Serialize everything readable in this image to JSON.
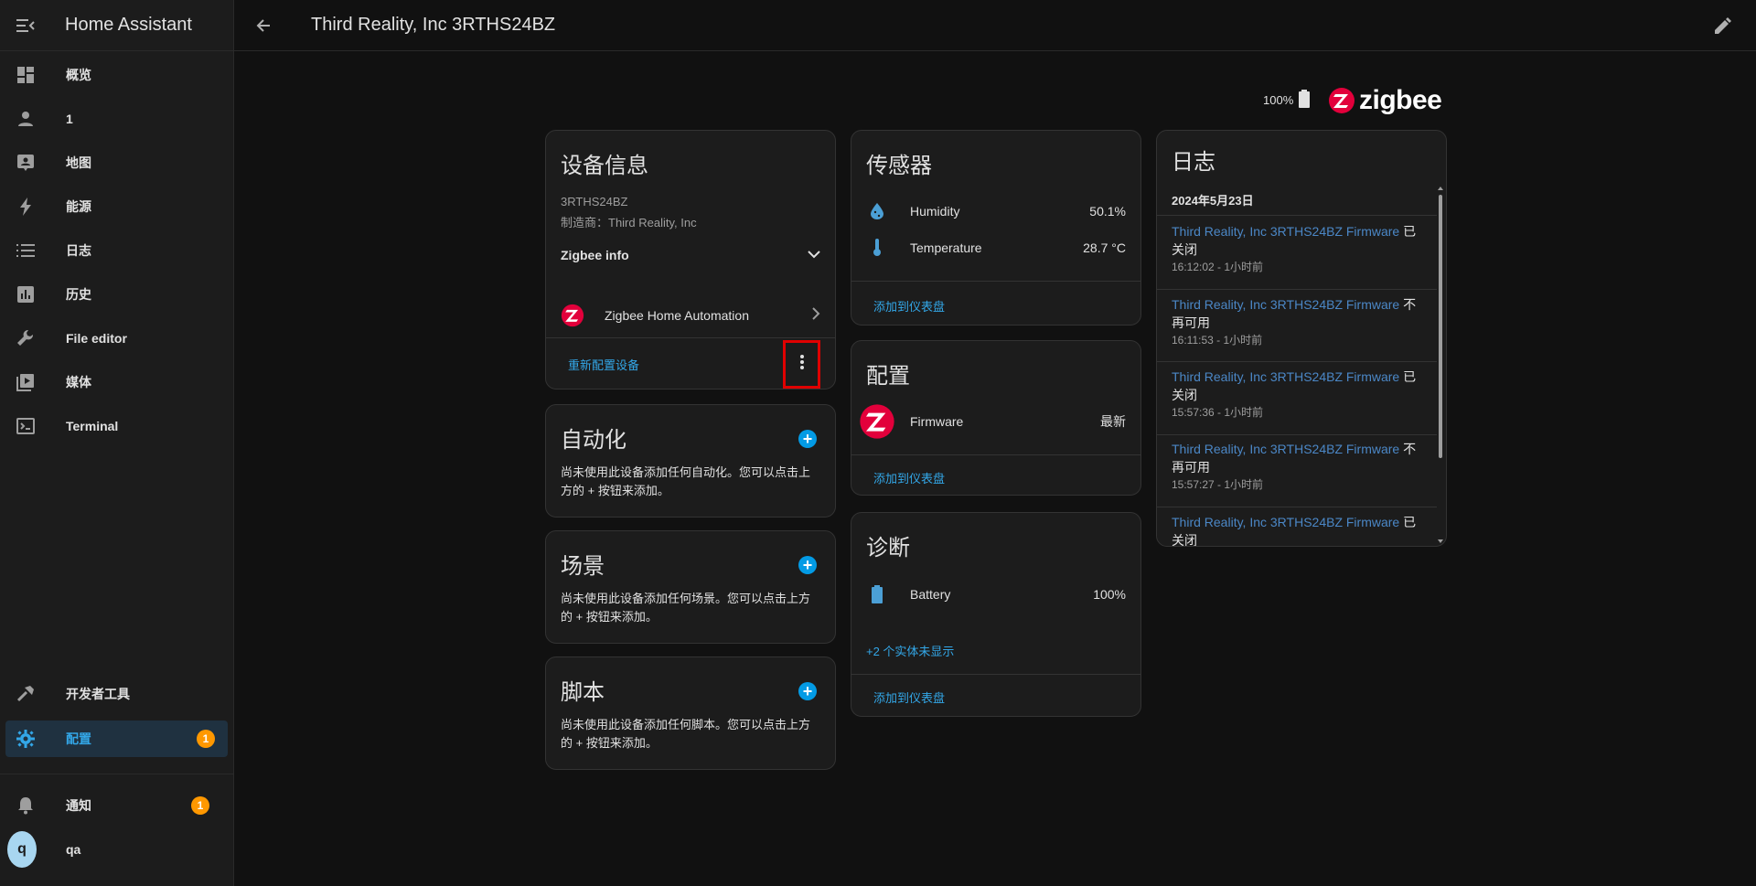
{
  "sidebar": {
    "title": "Home Assistant",
    "items": [
      {
        "label": "概览",
        "icon": "dashboard-icon"
      },
      {
        "label": "1",
        "icon": "person-icon"
      },
      {
        "label": "地图",
        "icon": "map-icon"
      },
      {
        "label": "能源",
        "icon": "lightning-icon"
      },
      {
        "label": "日志",
        "icon": "list-icon"
      },
      {
        "label": "历史",
        "icon": "chart-icon"
      },
      {
        "label": "File editor",
        "icon": "wrench-icon"
      },
      {
        "label": "媒体",
        "icon": "media-icon"
      },
      {
        "label": "Terminal",
        "icon": "terminal-icon"
      }
    ],
    "dev_tools": "开发者工具",
    "config": "配置",
    "config_badge": "1",
    "notifications": "通知",
    "notifications_badge": "1",
    "user_initial": "q",
    "user_name": "qa"
  },
  "header": {
    "title": "Third Reality, Inc 3RTHS24BZ"
  },
  "battery_top": "100%",
  "brand": "zigbee",
  "device_info": {
    "title": "设备信息",
    "model": "3RTHS24BZ",
    "manufacturer": "制造商：Third Reality, Inc",
    "zigbee_info": "Zigbee info",
    "integration": "Zigbee Home Automation",
    "reconfigure": "重新配置设备"
  },
  "automation": {
    "title": "自动化",
    "text": "尚未使用此设备添加任何自动化。您可以点击上方的 + 按钮来添加。"
  },
  "scene": {
    "title": "场景",
    "text": "尚未使用此设备添加任何场景。您可以点击上方的 + 按钮来添加。"
  },
  "script": {
    "title": "脚本",
    "text": "尚未使用此设备添加任何脚本。您可以点击上方的 + 按钮来添加。"
  },
  "sensors": {
    "title": "传感器",
    "rows": [
      {
        "name": "Humidity",
        "value": "50.1%",
        "icon": "water-percent-icon"
      },
      {
        "name": "Temperature",
        "value": "28.7 °C",
        "icon": "thermometer-icon"
      }
    ],
    "add_dashboard": "添加到仪表盘"
  },
  "configuration": {
    "title": "配置",
    "firmware_name": "Firmware",
    "firmware_value": "最新",
    "add_dashboard": "添加到仪表盘"
  },
  "diagnostics": {
    "title": "诊断",
    "battery_name": "Battery",
    "battery_value": "100%",
    "hidden_entities": "+2 个实体未显示",
    "add_dashboard": "添加到仪表盘"
  },
  "logbook": {
    "title": "日志",
    "date": "2024年5月23日",
    "entries": [
      {
        "link": "Third Reality, Inc 3RTHS24BZ Firmware",
        "action1": " 已",
        "action2": "关闭",
        "time": "16:12:02 - 1小时前"
      },
      {
        "link": "Third Reality, Inc 3RTHS24BZ Firmware",
        "action1": " 不",
        "action2": "再可用",
        "time": "16:11:53 - 1小时前"
      },
      {
        "link": "Third Reality, Inc 3RTHS24BZ Firmware",
        "action1": " 已",
        "action2": "关闭",
        "time": "15:57:36 - 1小时前"
      },
      {
        "link": "Third Reality, Inc 3RTHS24BZ Firmware",
        "action1": " 不",
        "action2": "再可用",
        "time": "15:57:27 - 1小时前"
      },
      {
        "link": "Third Reality, Inc 3RTHS24BZ Firmware",
        "action1": " 已",
        "action2": "关闭",
        "time": ""
      }
    ]
  },
  "colors": {
    "accent": "#33a7e8",
    "badge": "#ff9800",
    "highlight": "#e00000",
    "zigbee_red": "#e2003b"
  }
}
